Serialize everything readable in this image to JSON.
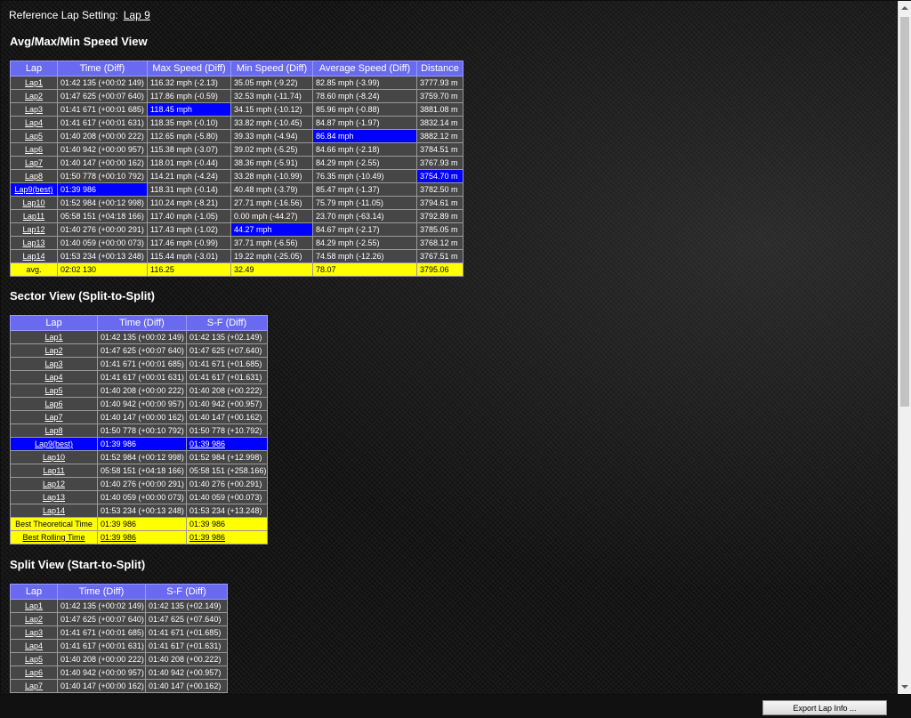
{
  "reference": {
    "label": "Reference Lap Setting:",
    "lap": "Lap 9"
  },
  "speed_view": {
    "title": "Avg/Max/Min Speed View",
    "headers": [
      "Lap",
      "Time (Diff)",
      "Max Speed (Diff)",
      "Min Speed (Diff)",
      "Average Speed (Diff)",
      "Distance"
    ],
    "rows": [
      {
        "lap": "Lap1",
        "time": "01:42 135 (+00:02 149)",
        "max": "116.32 mph (-2.13)",
        "min": "35.05 mph (-9.22)",
        "avg": "82.85 mph (-3.99)",
        "dist": "3777.93 m"
      },
      {
        "lap": "Lap2",
        "time": "01:47 625 (+00:07 640)",
        "max": "117.86 mph (-0.59)",
        "min": "32.53 mph (-11.74)",
        "avg": "78.60 mph (-8.24)",
        "dist": "3759.70 m"
      },
      {
        "lap": "Lap3",
        "time": "01:41 671 (+00:01 685)",
        "max": "118.45 mph",
        "min": "34.15 mph (-10.12)",
        "avg": "85.96 mph (-0.88)",
        "dist": "3881.08 m",
        "hl": [
          "max"
        ]
      },
      {
        "lap": "Lap4",
        "time": "01:41 617 (+00:01 631)",
        "max": "118.35 mph (-0.10)",
        "min": "33.82 mph (-10.45)",
        "avg": "84.87 mph (-1.97)",
        "dist": "3832.14 m"
      },
      {
        "lap": "Lap5",
        "time": "01:40 208 (+00:00 222)",
        "max": "112.65 mph (-5.80)",
        "min": "39.33 mph (-4.94)",
        "avg": "86.84 mph",
        "dist": "3882.12 m",
        "hl": [
          "avg"
        ]
      },
      {
        "lap": "Lap6",
        "time": "01:40 942 (+00:00 957)",
        "max": "115.38 mph (-3.07)",
        "min": "39.02 mph (-5.25)",
        "avg": "84.66 mph (-2.18)",
        "dist": "3784.51 m"
      },
      {
        "lap": "Lap7",
        "time": "01:40 147 (+00:00 162)",
        "max": "118.01 mph (-0.44)",
        "min": "38.36 mph (-5.91)",
        "avg": "84.29 mph (-2.55)",
        "dist": "3767.93 m"
      },
      {
        "lap": "Lap8",
        "time": "01:50 778 (+00:10 792)",
        "max": "114.21 mph (-4.24)",
        "min": "33.28 mph (-10.99)",
        "avg": "76.35 mph (-10.49)",
        "dist": "3754.70 m",
        "hl": [
          "dist"
        ]
      },
      {
        "lap": "Lap9(best)",
        "time": "01:39 986",
        "max": "118.31 mph (-0.14)",
        "min": "40.48 mph (-3.79)",
        "avg": "85.47 mph (-1.37)",
        "dist": "3782.50 m",
        "hl": [
          "lap",
          "time"
        ]
      },
      {
        "lap": "Lap10",
        "time": "01:52 984 (+00:12 998)",
        "max": "110.24 mph (-8.21)",
        "min": "27.71 mph (-16.56)",
        "avg": "75.79 mph (-11.05)",
        "dist": "3794.61 m"
      },
      {
        "lap": "Lap11",
        "time": "05:58 151 (+04:18 166)",
        "max": "117.40 mph (-1.05)",
        "min": "0.00 mph (-44.27)",
        "avg": "23.70 mph (-63.14)",
        "dist": "3792.89 m"
      },
      {
        "lap": "Lap12",
        "time": "01:40 276 (+00:00 291)",
        "max": "117.43 mph (-1.02)",
        "min": "44.27 mph",
        "avg": "84.67 mph (-2.17)",
        "dist": "3785.05 m",
        "hl": [
          "min"
        ]
      },
      {
        "lap": "Lap13",
        "time": "01:40 059 (+00:00 073)",
        "max": "117.46 mph (-0.99)",
        "min": "37.71 mph (-6.56)",
        "avg": "84.29 mph (-2.55)",
        "dist": "3768.12 m"
      },
      {
        "lap": "Lap14",
        "time": "01:53 234 (+00:13 248)",
        "max": "115.44 mph (-3.01)",
        "min": "19.22 mph (-25.05)",
        "avg": "74.58 mph (-12.26)",
        "dist": "3767.51 m"
      }
    ],
    "avg_row": {
      "lap": "avg.",
      "time": "02:02 130",
      "max": "116.25",
      "min": "32.49",
      "avg": "78.07",
      "dist": "3795.06"
    }
  },
  "sector_view": {
    "title": "Sector View (Split-to-Split)",
    "headers": [
      "Lap",
      "Time (Diff)",
      "S-F (Diff)"
    ],
    "rows": [
      {
        "lap": "Lap1",
        "time": "01:42 135 (+00:02 149)",
        "sf": "01:42 135 (+02.149)"
      },
      {
        "lap": "Lap2",
        "time": "01:47 625 (+00:07 640)",
        "sf": "01:47 625 (+07.640)"
      },
      {
        "lap": "Lap3",
        "time": "01:41 671 (+00:01 685)",
        "sf": "01:41 671 (+01.685)"
      },
      {
        "lap": "Lap4",
        "time": "01:41 617 (+00:01 631)",
        "sf": "01:41 617 (+01.631)"
      },
      {
        "lap": "Lap5",
        "time": "01:40 208 (+00:00 222)",
        "sf": "01:40 208 (+00.222)"
      },
      {
        "lap": "Lap6",
        "time": "01:40 942 (+00:00 957)",
        "sf": "01:40 942 (+00.957)"
      },
      {
        "lap": "Lap7",
        "time": "01:40 147 (+00:00 162)",
        "sf": "01:40 147 (+00.162)"
      },
      {
        "lap": "Lap8",
        "time": "01:50 778 (+00:10 792)",
        "sf": "01:50 778 (+10.792)"
      },
      {
        "lap": "Lap9(best)",
        "time": "01:39 986",
        "sf": "01:39 986",
        "best": true
      },
      {
        "lap": "Lap10",
        "time": "01:52 984 (+00:12 998)",
        "sf": "01:52 984 (+12.998)"
      },
      {
        "lap": "Lap11",
        "time": "05:58 151 (+04:18 166)",
        "sf": "05:58 151 (+258.166)"
      },
      {
        "lap": "Lap12",
        "time": "01:40 276 (+00:00 291)",
        "sf": "01:40 276 (+00.291)"
      },
      {
        "lap": "Lap13",
        "time": "01:40 059 (+00:00 073)",
        "sf": "01:40 059 (+00.073)"
      },
      {
        "lap": "Lap14",
        "time": "01:53 234 (+00:13 248)",
        "sf": "01:53 234 (+13.248)"
      }
    ],
    "summary": [
      {
        "label": "Best Theoretical Time",
        "time": "01:39 986",
        "sf": "01:39 986",
        "underline": false
      },
      {
        "label": "Best Rolling Time",
        "time": "01:39 986",
        "sf": "01:39 986",
        "underline": true
      }
    ]
  },
  "split_view": {
    "title": "Split View (Start-to-Split)",
    "headers": [
      "Lap",
      "Time (Diff)",
      "S-F (Diff)"
    ],
    "rows": [
      {
        "lap": "Lap1",
        "time": "01:42 135 (+00:02 149)",
        "sf": "01:42 135 (+02.149)"
      },
      {
        "lap": "Lap2",
        "time": "01:47 625 (+00:07 640)",
        "sf": "01:47 625 (+07.640)"
      },
      {
        "lap": "Lap3",
        "time": "01:41 671 (+00:01 685)",
        "sf": "01:41 671 (+01.685)"
      },
      {
        "lap": "Lap4",
        "time": "01:41 617 (+00:01 631)",
        "sf": "01:41 617 (+01.631)"
      },
      {
        "lap": "Lap5",
        "time": "01:40 208 (+00:00 222)",
        "sf": "01:40 208 (+00.222)"
      },
      {
        "lap": "Lap6",
        "time": "01:40 942 (+00:00 957)",
        "sf": "01:40 942 (+00.957)"
      },
      {
        "lap": "Lap7",
        "time": "01:40 147 (+00:00 162)",
        "sf": "01:40 147 (+00.162)"
      }
    ]
  },
  "footer": {
    "export_label": "Export Lap Info ..."
  },
  "colors": {
    "header_blue": "#6a6af0",
    "highlight_blue": "#0000ff",
    "avg_yellow": "#ffff00",
    "cell_gray": "#464646"
  }
}
